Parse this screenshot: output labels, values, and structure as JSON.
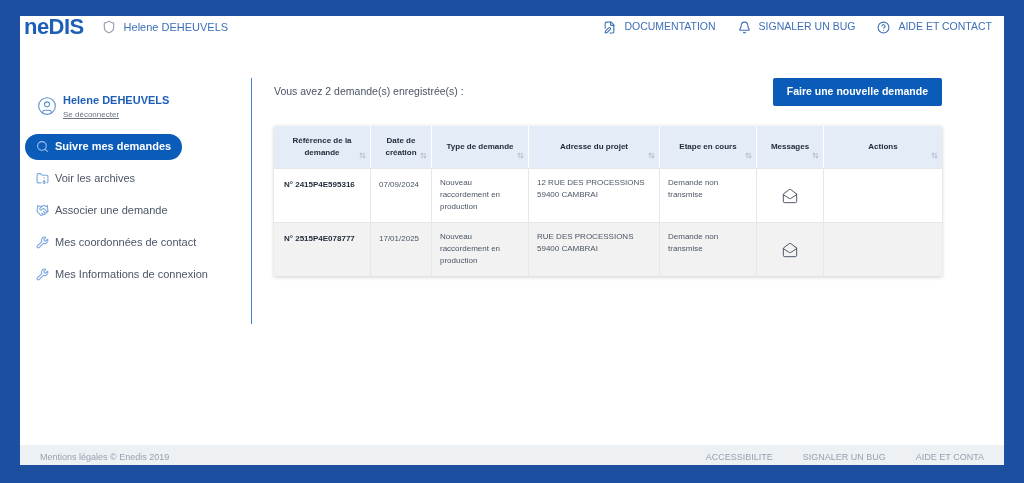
{
  "header": {
    "logo": "neDIS",
    "user_name": "Helene DEHEUVELS",
    "links": [
      {
        "kind": "doc",
        "label": "DOCUMENTATION"
      },
      {
        "kind": "bell",
        "label": "SIGNALER UN BUG"
      },
      {
        "kind": "help",
        "label": "AIDE ET CONTACT"
      }
    ]
  },
  "sidebar": {
    "user_name": "Helene DEHEUVELS",
    "logout": "Se déconnecter",
    "items": [
      {
        "kind": "search",
        "label": "Suivre mes demandes",
        "selected": true
      },
      {
        "kind": "folder",
        "label": "Voir les archives",
        "selected": false
      },
      {
        "kind": "handshake",
        "label": "Associer une demande",
        "selected": false
      },
      {
        "kind": "wrench",
        "label": "Mes coordonnées de contact",
        "selected": false
      },
      {
        "kind": "wrench",
        "label": "Mes Informations de connexion",
        "selected": false
      }
    ]
  },
  "main": {
    "summary": "Vous avez 2 demande(s) enregistrée(s) :",
    "new_button": "Faire une nouvelle demande",
    "table": {
      "columns": [
        "Référence de la demande",
        "Date de création",
        "Type de demande",
        "Adresse du projet",
        "Etape en cours",
        "Messages",
        "Actions"
      ],
      "rows": [
        {
          "reference": "N° 2415P4E595316",
          "date": "07/09/2024",
          "type": "Nouveau raccordement en production",
          "address": [
            "12 RUE DES PROCESSIONS",
            "59400 CAMBRAI"
          ],
          "step": "Demande non transmise"
        },
        {
          "reference": "N° 2515P4E078777",
          "date": "17/01/2025",
          "type": "Nouveau raccordement en production",
          "address": [
            "RUE DES PROCESSIONS",
            "59400 CAMBRAI"
          ],
          "step": "Demande non transmise"
        }
      ]
    }
  },
  "footer": {
    "legal": "Mentions légales © Enedis 2019",
    "links": [
      "ACCESSIBILITE",
      "SIGNALER UN BUG",
      "AIDE ET CONTA"
    ]
  }
}
